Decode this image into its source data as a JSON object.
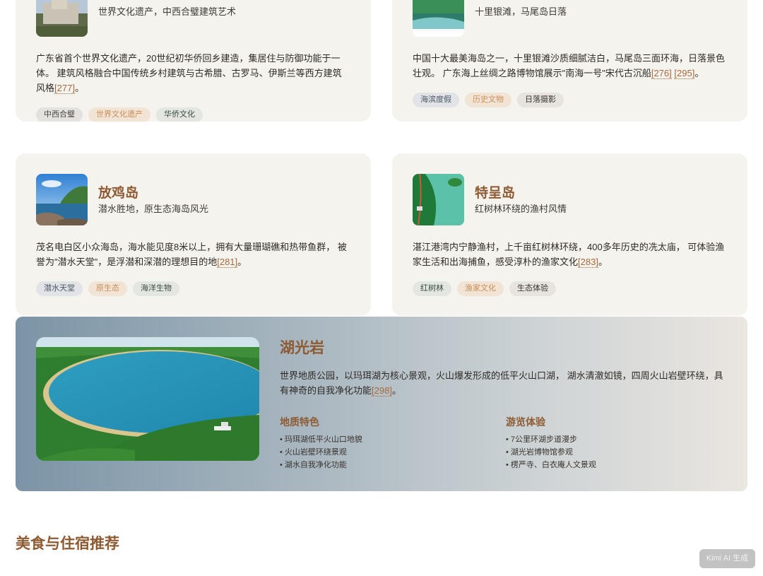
{
  "cards_top": [
    {
      "subtitle": "世界文化遗产，中西合璧建筑艺术",
      "description": "广东省首个世界文化遗产，20世纪初华侨回乡建造，集居住与防御功能于一体。 建筑风格融合中国传统乡村建筑与古希腊、古罗马、伊斯兰等西方建筑风格",
      "citations": [
        "[277]"
      ],
      "tail": "。",
      "tags": [
        "中西合璧",
        "世界文化遗产",
        "华侨文化"
      ]
    },
    {
      "subtitle": "十里银滩，马尾岛日落",
      "description": "中国十大最美海岛之一，十里银滩沙质细腻洁白，马尾岛三面环海，日落景色壮观。 广东海上丝绸之路博物馆展示\"南海一号\"宋代古沉船",
      "citations": [
        "[276]",
        "[295]"
      ],
      "tail": "。",
      "tags": [
        "海滨度假",
        "历史文物",
        "日落摄影"
      ]
    }
  ],
  "cards_mid": [
    {
      "title": "放鸡岛",
      "subtitle": "潜水胜地，原生态海岛风光",
      "description": "茂名电白区小众海岛，海水能见度8米以上，拥有大量珊瑚礁和热带鱼群， 被誉为\"潜水天堂\"，是浮潜和深潜的理想目的地",
      "citations": [
        "[281]"
      ],
      "tail": "。",
      "tags": [
        "潜水天堂",
        "原生态",
        "海洋生物"
      ]
    },
    {
      "title": "特呈岛",
      "subtitle": "红树林环绕的渔村风情",
      "description": "湛江港湾内宁静渔村，上千亩红树林环绕，400多年历史的冼太庙， 可体验渔家生活和出海捕鱼，感受淳朴的渔家文化",
      "citations": [
        "[283]"
      ],
      "tail": "。",
      "tags": [
        "红树林",
        "渔家文化",
        "生态体验"
      ]
    }
  ],
  "feature": {
    "title": "湖光岩",
    "description": "世界地质公园，以玛珥湖为核心景观，火山爆发形成的低平火山口湖， 湖水清澈如镜，四周火山岩壁环绕，具有神奇的自我净化功能",
    "citation": "[298]",
    "tail": "。",
    "geology_title": "地质特色",
    "geology": [
      "玛珥湖低平火山口地貌",
      "火山岩壁环绕景观",
      "湖水自我净化功能"
    ],
    "visit_title": "游览体验",
    "visit": [
      "7公里环湖步道漫步",
      "湖光岩博物馆参观",
      "楞严寺、白衣庵人文景观"
    ]
  },
  "section_title": "美食与住宿推荐",
  "watermark": "Kimi AI 生成"
}
